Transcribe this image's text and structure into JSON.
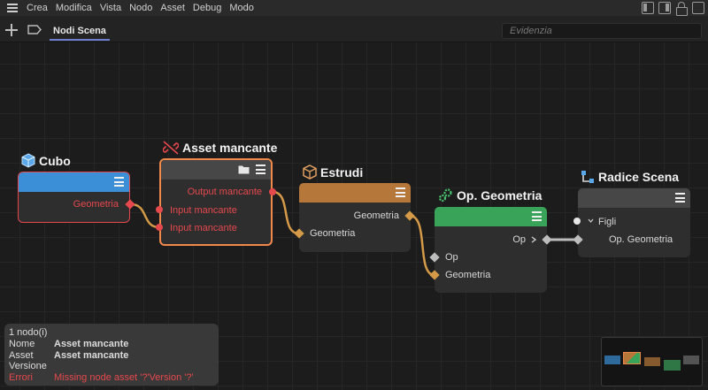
{
  "menubar": {
    "items": [
      "Crea",
      "Modifica",
      "Vista",
      "Nodo",
      "Asset",
      "Debug",
      "Modo"
    ]
  },
  "toolbar": {
    "tab_label": "Nodi Scena",
    "search_placeholder": "Evidenzia"
  },
  "nodes": {
    "cubo": {
      "title": "Cubo",
      "icon": "cube-icon",
      "color": "#3a8fd6",
      "ports": {
        "output": "Geometria"
      }
    },
    "asset_mancante": {
      "title": "Asset mancante",
      "icon": "broken-link-icon",
      "color": "#4a4a4a",
      "ports": {
        "output": "Output mancante",
        "input1": "Input mancante",
        "input2": "Input mancante"
      }
    },
    "estrudi": {
      "title": "Estrudi",
      "icon": "extrude-icon",
      "color": "#b5773a",
      "ports": {
        "output": "Geometria",
        "input": "Geometria"
      }
    },
    "op_geometria": {
      "title": "Op. Geometria",
      "icon": "gears-icon",
      "color": "#3aa35a",
      "ports": {
        "output": "Op",
        "input_op": "Op",
        "input_geo": "Geometria"
      }
    },
    "radice_scena": {
      "title": "Radice Scena",
      "icon": "scene-root-icon",
      "color": "#4a4a4a",
      "ports": {
        "children": "Figli",
        "child": "Op. Geometria"
      }
    }
  },
  "info_panel": {
    "count": "1 nodo(i)",
    "rows": [
      {
        "key": "Nome",
        "value": "Asset mancante"
      },
      {
        "key": "Asset",
        "value": "Asset mancante"
      },
      {
        "key": "Versione",
        "value": ""
      },
      {
        "key": "Errori",
        "value": "Missing node asset '?'Version '?'"
      }
    ]
  },
  "colors": {
    "error": "#e5484d",
    "selected_border": "#f0884a",
    "wire_orange": "#d49a48",
    "wire_grey": "#bdbdbd"
  }
}
